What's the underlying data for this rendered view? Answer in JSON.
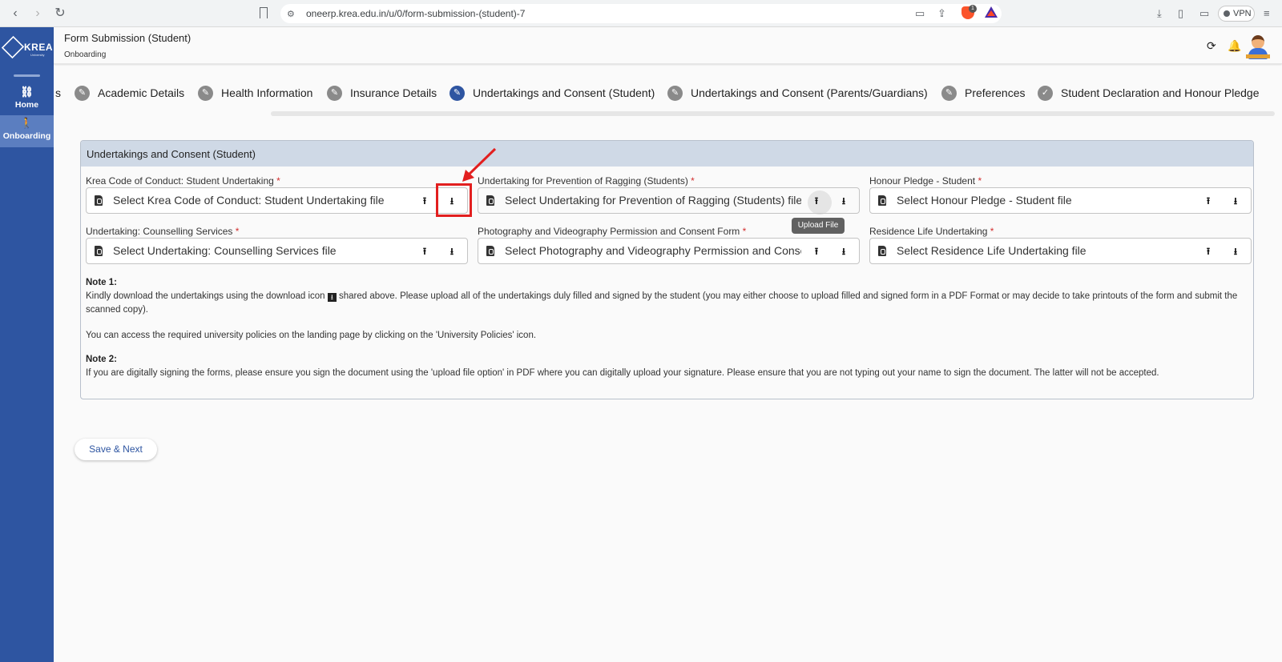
{
  "browser": {
    "url": "oneerp.krea.edu.in/u/0/form-submission-(student)-7",
    "brave_badge": "1",
    "vpn_label": "VPN"
  },
  "sidebar": {
    "logo_text": "KREA",
    "logo_sub": "University",
    "items": [
      {
        "label": "Home",
        "icon": "link-icon"
      },
      {
        "label": "Onboarding",
        "icon": "person-walking-icon"
      }
    ]
  },
  "header": {
    "title": "Form Submission (Student)",
    "breadcrumb": "Onboarding"
  },
  "stepper": {
    "steps": [
      {
        "label": "s",
        "active": false
      },
      {
        "label": "Academic Details",
        "active": false
      },
      {
        "label": "Health Information",
        "active": false
      },
      {
        "label": "Insurance Details",
        "active": false
      },
      {
        "label": "Undertakings and Consent (Student)",
        "active": true
      },
      {
        "label": "Undertakings and Consent (Parents/Guardians)",
        "active": false
      },
      {
        "label": "Preferences",
        "active": false
      },
      {
        "label": "Student Declaration and Honour Pledge",
        "active": false
      }
    ]
  },
  "card": {
    "title": "Undertakings and Consent (Student)",
    "fields": [
      {
        "label": "Krea Code of Conduct: Student Undertaking",
        "required": "*",
        "placeholder": "Select Krea Code of Conduct: Student Undertaking file"
      },
      {
        "label": "Undertaking for Prevention of Ragging (Students)",
        "required": "*",
        "placeholder": "Select Undertaking for Prevention of Ragging (Students) file"
      },
      {
        "label": "Honour Pledge - Student",
        "required": "*",
        "placeholder": "Select Honour Pledge - Student file"
      },
      {
        "label": "Undertaking: Counselling Services",
        "required": "*",
        "placeholder": "Select Undertaking: Counselling Services file"
      },
      {
        "label": "Photography and Videography Permission and Consent Form",
        "required": "*",
        "placeholder": "Select Photography and Videography Permission and Consent Form file"
      },
      {
        "label": "Residence Life Undertaking",
        "required": "*",
        "placeholder": "Select Residence Life Undertaking file"
      }
    ],
    "tooltip": "Upload File",
    "note1_heading": "Note 1:",
    "note1_text_a": "Kindly download the undertakings using the download icon",
    "note1_text_b": "shared above. Please upload all of the undertakings duly filled and signed by the student (you may either choose to upload filled and signed form in a PDF Format or may decide to take printouts of the form and submit the scanned copy).",
    "note1_text_c": "You can access the required university policies on the landing page by clicking on the 'University Policies' icon.",
    "note2_heading": "Note 2:",
    "note2_text": "If you are digitally signing the forms, please ensure you sign the document using the 'upload file option' in PDF where you can digitally upload your signature. Please ensure that you are not typing out your name to sign the document. The latter will not be accepted."
  },
  "actions": {
    "save_next": "Save & Next"
  },
  "colors": {
    "brand": "#2e55a1",
    "card_header": "#cfd9e6",
    "annotation": "#e21f1f"
  }
}
